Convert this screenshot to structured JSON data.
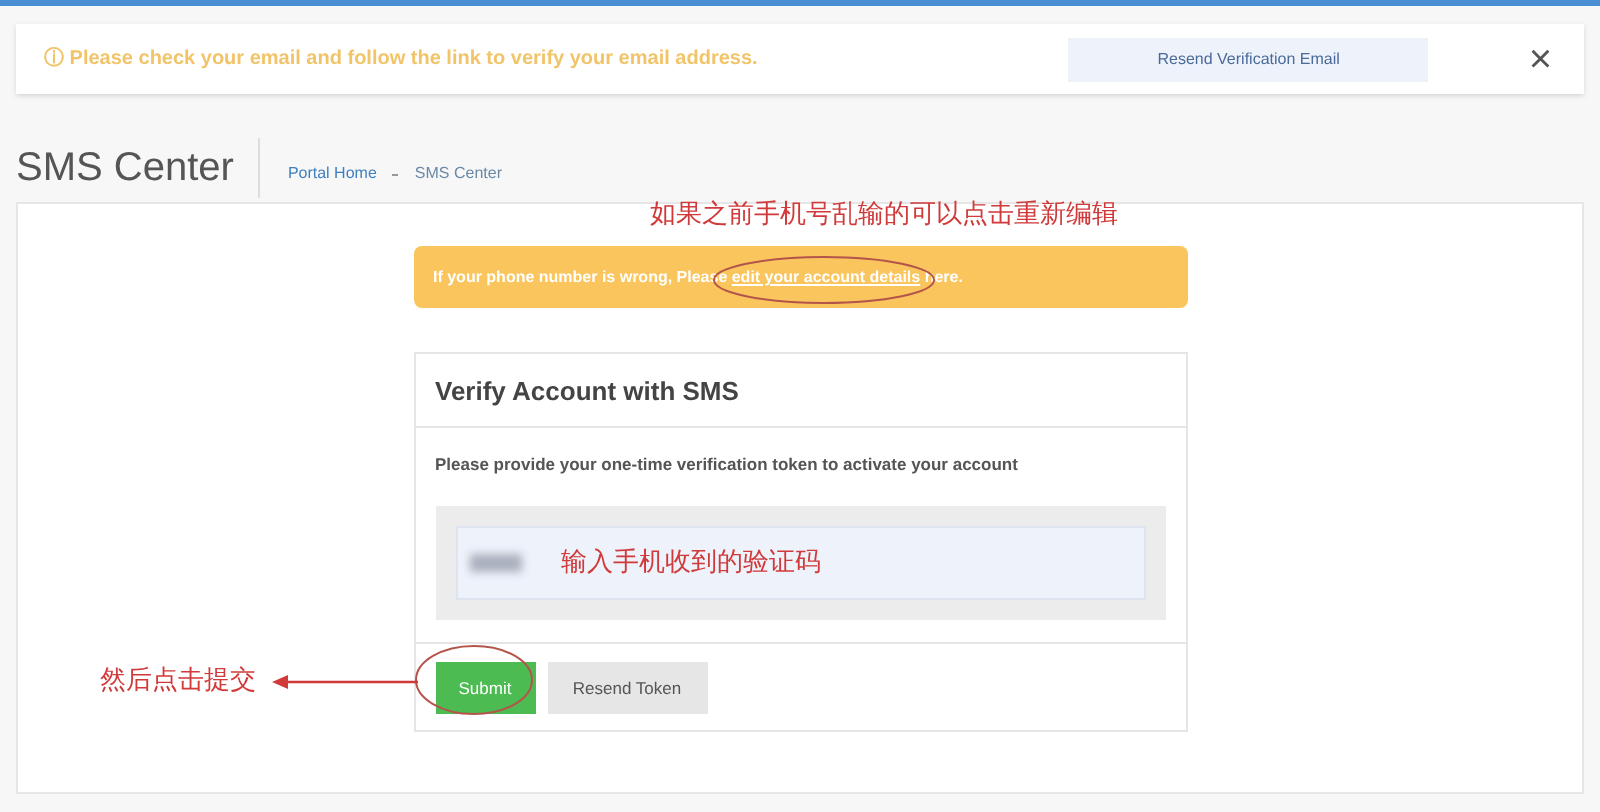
{
  "email_alert": {
    "icon": "ⓘ",
    "message": "Please check your email and follow the link to verify your email address.",
    "button": "Resend Verification Email",
    "close": "×"
  },
  "header": {
    "title": "SMS Center",
    "breadcrumb": [
      {
        "label": "Portal Home",
        "selected": false
      },
      {
        "label": "SMS Center",
        "selected": true
      }
    ]
  },
  "phone_warning": {
    "parts": [
      "If your phone number is wrong, Please ",
      "edit your account details",
      "here."
    ]
  },
  "card": {
    "title": "Verify Account with SMS",
    "instructions": "Please provide your one-time verification token to activate your account",
    "buttons": [
      {
        "label": "Submit",
        "kind": "primary"
      },
      {
        "label": "Resend Token",
        "kind": "default"
      }
    ]
  },
  "annotations": [
    {
      "kind": "note",
      "text": "如果之前手机号乱输的可以点击重新编辑"
    },
    {
      "kind": "field",
      "text": "输入手机收到的验证码"
    },
    {
      "kind": "arrow",
      "text": "然后点击提交"
    }
  ]
}
